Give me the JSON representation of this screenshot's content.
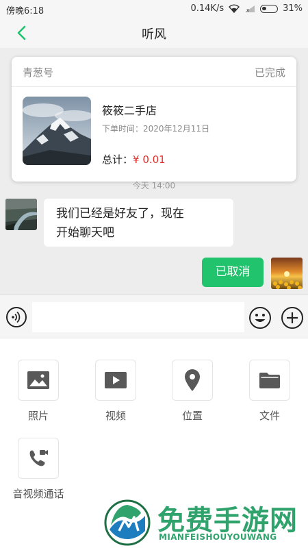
{
  "status_bar": {
    "time": "傍晚6:18",
    "network_speed": "0.14K/s",
    "battery": "31%"
  },
  "nav": {
    "title": "听风",
    "back_icon": "chevron-left-icon",
    "accent": "#22c36d"
  },
  "order_card": {
    "store_label": "青葱号",
    "status": "已完成",
    "shop_name": "筱筱二手店",
    "order_time": "下单时间：2020年12月11日",
    "total_label": "总计：",
    "total_price": "¥ 0.01",
    "price_color": "#e0302c"
  },
  "messages": {
    "timestamp": "今天 14:00",
    "incoming": {
      "line1": "我们已经是好友了，现在",
      "line2": "开始聊天吧"
    },
    "outgoing": {
      "text": "已取消"
    }
  },
  "input_bar": {
    "placeholder": "",
    "voice_icon": "voice-icon",
    "emoji_icon": "emoji-icon",
    "plus_icon": "plus-icon"
  },
  "tools": [
    {
      "label": "照片",
      "icon": "image-icon"
    },
    {
      "label": "视频",
      "icon": "video-icon"
    },
    {
      "label": "位置",
      "icon": "location-icon"
    },
    {
      "label": "文件",
      "icon": "folder-icon"
    },
    {
      "label": "音视频通话",
      "icon": "video-call-icon"
    }
  ],
  "watermark": {
    "title": "免费手游网",
    "subtitle": "MIANFEISHOUYOUWANG"
  }
}
